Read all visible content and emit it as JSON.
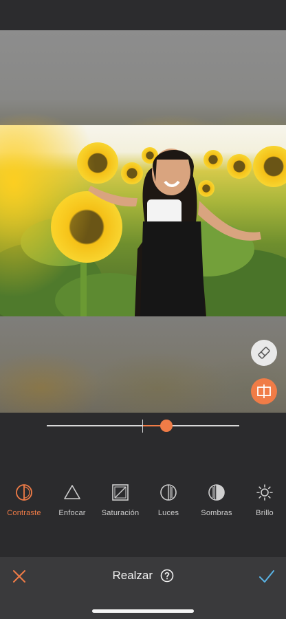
{
  "colors": {
    "accent": "#f07c47",
    "confirm": "#5ab4e6",
    "background": "#2b2b2d"
  },
  "photo": {
    "subject": "woman smiling in sunflower field"
  },
  "side_tools": {
    "eraser_icon": "eraser-icon",
    "compare_icon": "split-compare-icon"
  },
  "slider": {
    "value": 0.62
  },
  "tools": [
    {
      "label": "Contraste",
      "icon": "contrast-icon",
      "active": true
    },
    {
      "label": "Enfocar",
      "icon": "triangle-icon",
      "active": false
    },
    {
      "label": "Saturación",
      "icon": "saturation-icon",
      "active": false
    },
    {
      "label": "Luces",
      "icon": "highlights-icon",
      "active": false
    },
    {
      "label": "Sombras",
      "icon": "shadows-icon",
      "active": false
    },
    {
      "label": "Brillo",
      "icon": "sun-icon",
      "active": false
    }
  ],
  "bottom_bar": {
    "title": "Realzar",
    "help_icon": "question-circle-icon",
    "cancel_icon": "close-icon",
    "confirm_icon": "checkmark-icon"
  }
}
